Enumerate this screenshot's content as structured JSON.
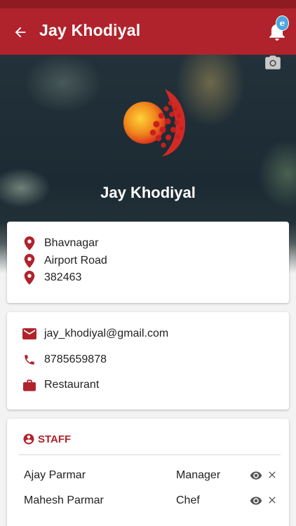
{
  "appbar": {
    "title": "Jay Khodiyal",
    "notification_badge": "e"
  },
  "profile": {
    "name": "Jay Khodiyal"
  },
  "address": {
    "city": "Bhavnagar",
    "street": "Airport Road",
    "pincode": "382463"
  },
  "contact": {
    "email": "jay_khodiyal@gmail.com",
    "phone": "8785659878",
    "business": "Restaurant"
  },
  "staff": {
    "heading": "STAFF",
    "members": [
      {
        "name": "Ajay Parmar",
        "role": "Manager"
      },
      {
        "name": "Mahesh Parmar",
        "role": "Chef"
      }
    ]
  },
  "colors": {
    "primary": "#b0232c",
    "status_bar": "#8e1a22",
    "badge": "#4ea6dc"
  },
  "icons": [
    "back-arrow-icon",
    "bell-icon",
    "camera-icon",
    "location-pin-icon",
    "email-icon",
    "phone-icon",
    "briefcase-icon",
    "account-circle-icon",
    "eye-icon",
    "close-icon"
  ]
}
